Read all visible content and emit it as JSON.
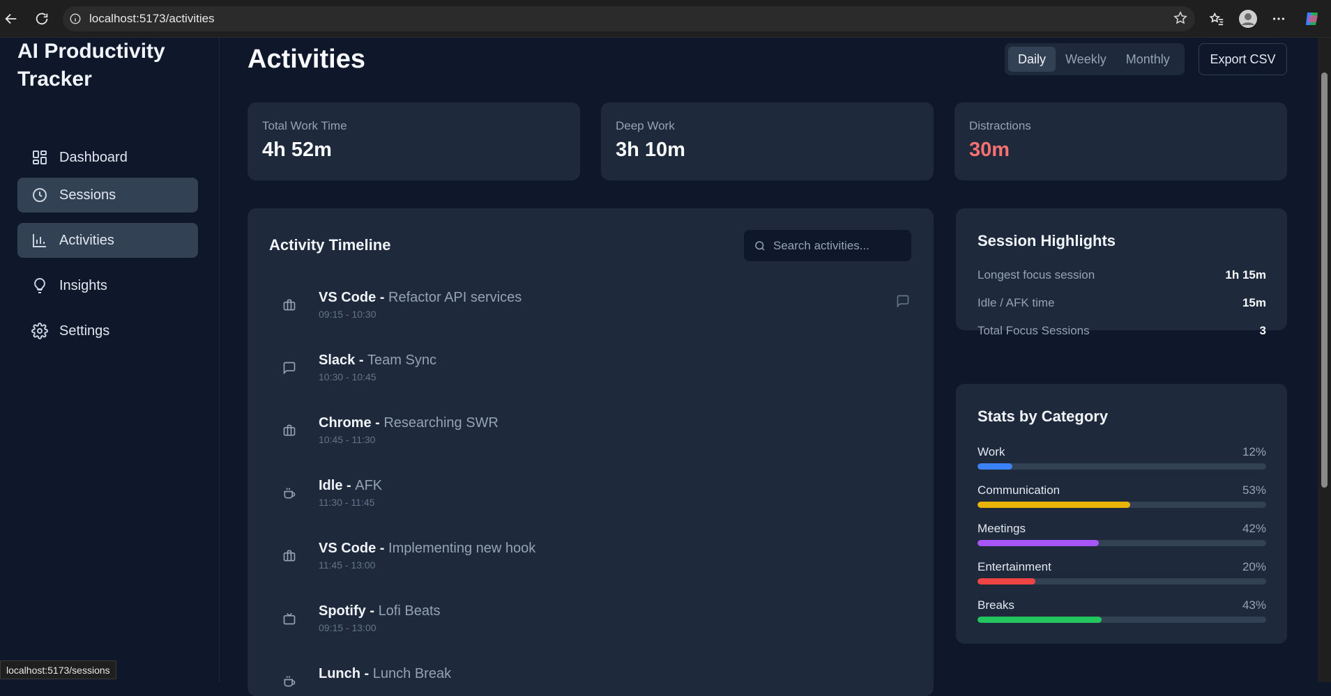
{
  "browser": {
    "url": "localhost:5173/activities",
    "status_url": "localhost:5173/sessions"
  },
  "sidebar": {
    "brand": "AI Productivity Tracker",
    "items": [
      {
        "label": "Dashboard",
        "icon": "grid-icon",
        "active": false
      },
      {
        "label": "Sessions",
        "icon": "clock-icon",
        "active": true
      },
      {
        "label": "Activities",
        "icon": "bar-chart-icon",
        "active": true
      },
      {
        "label": "Insights",
        "icon": "lightbulb-icon",
        "active": false
      },
      {
        "label": "Settings",
        "icon": "gear-icon",
        "active": false
      }
    ]
  },
  "header": {
    "title": "Activities",
    "range_options": [
      "Daily",
      "Weekly",
      "Monthly"
    ],
    "range_selected": "Daily",
    "export_label": "Export CSV"
  },
  "stats": [
    {
      "label": "Total Work Time",
      "value": "4h 52m"
    },
    {
      "label": "Deep Work",
      "value": "3h 10m"
    },
    {
      "label": "Distractions",
      "value": "30m",
      "color": "#f87171"
    }
  ],
  "timeline": {
    "title": "Activity Timeline",
    "search_placeholder": "Search activities...",
    "items": [
      {
        "app": "VS Code",
        "sep": " - ",
        "task": "Refactor API services",
        "time": "09:15 - 10:30",
        "icon": "briefcase-icon"
      },
      {
        "app": "Slack",
        "sep": " - ",
        "task": "Team Sync",
        "time": "10:30 - 10:45",
        "icon": "message-icon"
      },
      {
        "app": "Chrome",
        "sep": " - ",
        "task": "Researching SWR",
        "time": "10:45 - 11:30",
        "icon": "briefcase-icon"
      },
      {
        "app": "Idle",
        "sep": " - ",
        "task": "AFK",
        "time": "11:30 - 11:45",
        "icon": "coffee-icon"
      },
      {
        "app": "VS Code",
        "sep": " - ",
        "task": "Implementing new hook",
        "time": "11:45 - 13:00",
        "icon": "briefcase-icon"
      },
      {
        "app": "Spotify",
        "sep": " - ",
        "task": "Lofi Beats",
        "time": "09:15 - 13:00",
        "icon": "tv-icon"
      },
      {
        "app": "Lunch",
        "sep": " - ",
        "task": "Lunch Break",
        "time": "",
        "icon": "coffee-icon"
      }
    ]
  },
  "highlights": {
    "title": "Session Highlights",
    "rows": [
      {
        "label": "Longest focus session",
        "value": "1h 15m"
      },
      {
        "label": "Idle / AFK time",
        "value": "15m"
      },
      {
        "label": "Total Focus Sessions",
        "value": "3"
      }
    ]
  },
  "categories": {
    "title": "Stats by Category",
    "rows": [
      {
        "name": "Work",
        "percent_label": "12%",
        "fraction": 0.12,
        "color": "#3b82f6"
      },
      {
        "name": "Communication",
        "percent_label": "53%",
        "fraction": 0.53,
        "color": "#eab308"
      },
      {
        "name": "Meetings",
        "percent_label": "42%",
        "fraction": 0.42,
        "color": "#a855f7"
      },
      {
        "name": "Entertainment",
        "percent_label": "20%",
        "fraction": 0.2,
        "color": "#ef4444"
      },
      {
        "name": "Breaks",
        "percent_label": "43%",
        "fraction": 0.43,
        "color": "#22c55e"
      }
    ]
  }
}
